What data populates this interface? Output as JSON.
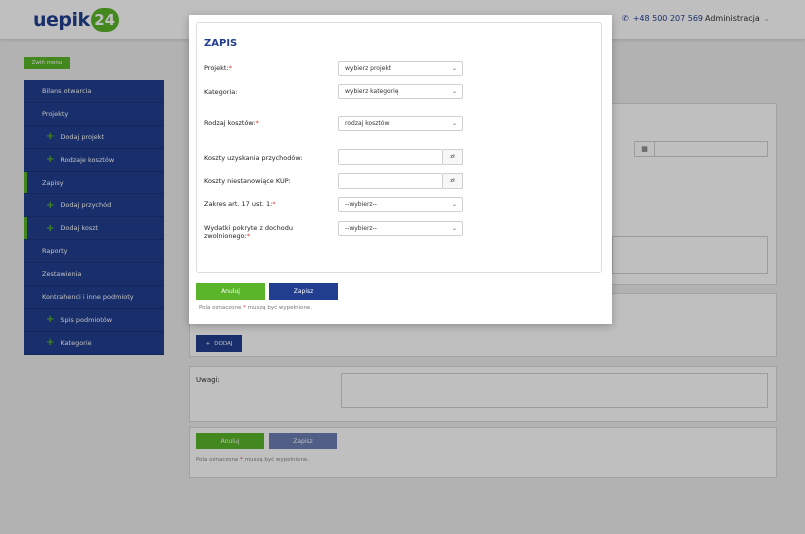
{
  "header": {
    "logo_text": "uepik",
    "logo_badge": "24",
    "phone": "+48 500 207 569",
    "admin": "Administracja"
  },
  "menu_button": "Zwiń menu",
  "sidebar": {
    "items": [
      {
        "label": "Bilans otwarcia",
        "sub": false
      },
      {
        "label": "Projekty",
        "sub": false
      },
      {
        "label": "Dodaj projekt",
        "sub": true
      },
      {
        "label": "Rodzaje kosztów",
        "sub": true
      },
      {
        "label": "Zapisy",
        "sub": false
      },
      {
        "label": "Dodaj przychód",
        "sub": true
      },
      {
        "label": "Dodaj koszt",
        "sub": true
      },
      {
        "label": "Raporty",
        "sub": false
      },
      {
        "label": "Zestawienia",
        "sub": false
      },
      {
        "label": "Kontrahenci i inne podmioty",
        "sub": false
      },
      {
        "label": "Spis podmiotów",
        "sub": true
      },
      {
        "label": "Kategorie",
        "sub": true
      }
    ]
  },
  "background": {
    "dodaj_label": "DODAJ",
    "uwagi_label": "Uwagi:",
    "anuluj_label": "Anuluj",
    "zapisz_label": "Zapisz",
    "note_before": "Pola oznaczone",
    "note_star": "*",
    "note_after": "muszą być wypełnione."
  },
  "modal": {
    "title": "ZAPIS",
    "fields": {
      "projekt_label": "Projekt:",
      "projekt_value": "wybierz projekt",
      "kategoria_label": "Kategoria:",
      "kategoria_value": "wybierz kategorię",
      "rodzaj_label": "Rodzaj kosztów:",
      "rodzaj_value": "rodzaj kosztów",
      "koszty_uzyskania_label": "Koszty uzyskania przychodów:",
      "koszty_uzyskania_unit": "zł",
      "koszty_niest_label": "Koszty niestanowiące KUP:",
      "koszty_niest_unit": "zł",
      "zakres_label": "Zakres art. 17 ust. 1:",
      "zakres_value": "--wybierz--",
      "wydatki_label_1": "Wydatki pokryte z dochodu",
      "wydatki_label_2": "zwolnionego:",
      "wydatki_value": "--wybierz--"
    },
    "required_star": "*",
    "anuluj_label": "Anuluj",
    "zapisz_label": "Zapisz",
    "note_before": "Pola oznaczone",
    "note_star": "*",
    "note_after": "muszą być wypełnione."
  }
}
